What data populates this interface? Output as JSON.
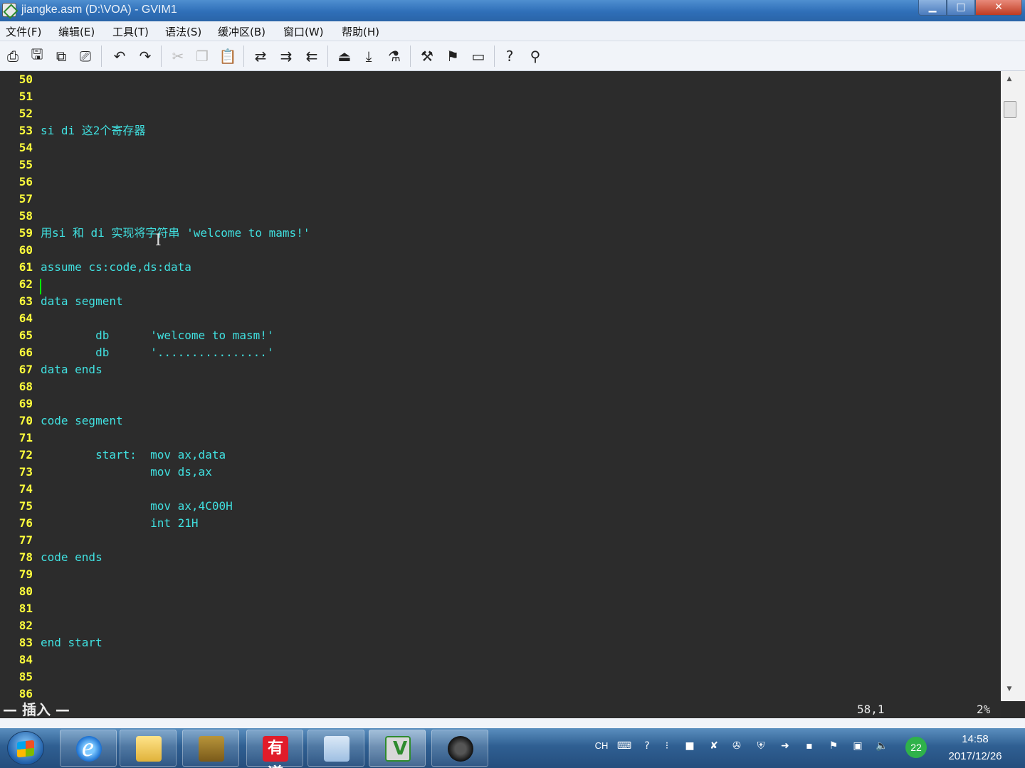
{
  "window": {
    "title": "jiangke.asm (D:\\VOA) - GVIM1",
    "minimize": "▁",
    "maximize": "□",
    "close": "✕"
  },
  "menu": [
    "文件(F)",
    "编辑(E)",
    "工具(T)",
    "语法(S)",
    "缓冲区(B)",
    "窗口(W)",
    "帮助(H)"
  ],
  "toolbar": {
    "icons": [
      "open-icon",
      "save-icon",
      "save-all-icon",
      "print-icon",
      "undo-icon",
      "redo-icon",
      "cut-icon",
      "copy-icon",
      "paste-icon",
      "find-replace-icon",
      "find-next-icon",
      "find-prev-icon",
      "load-session-icon",
      "save-session-icon",
      "run-script-icon",
      "make-icon",
      "shell-icon",
      "tag-jump-icon",
      "help-icon",
      "find-help-icon"
    ]
  },
  "editor": {
    "lines": [
      {
        "n": "50",
        "text": ""
      },
      {
        "n": "51",
        "text": ""
      },
      {
        "n": "52",
        "text": ""
      },
      {
        "n": "53",
        "text": "si di 这2个寄存器"
      },
      {
        "n": "54",
        "text": ""
      },
      {
        "n": "55",
        "text": ""
      },
      {
        "n": "56",
        "text": ""
      },
      {
        "n": "57",
        "text": ""
      },
      {
        "n": "58",
        "text": ""
      },
      {
        "n": "59",
        "text": "用si 和 di 实现将字符串 'welcome to mams!'"
      },
      {
        "n": "60",
        "text": ""
      },
      {
        "n": "61",
        "text": "assume cs:code,ds:data"
      },
      {
        "n": "62",
        "text": ""
      },
      {
        "n": "63",
        "text": "data segment"
      },
      {
        "n": "64",
        "text": ""
      },
      {
        "n": "65",
        "text": "        db      'welcome to masm!'"
      },
      {
        "n": "66",
        "text": "        db      '................'"
      },
      {
        "n": "67",
        "text": "data ends"
      },
      {
        "n": "68",
        "text": ""
      },
      {
        "n": "69",
        "text": ""
      },
      {
        "n": "70",
        "text": "code segment"
      },
      {
        "n": "71",
        "text": ""
      },
      {
        "n": "72",
        "text": "        start:  mov ax,data"
      },
      {
        "n": "73",
        "text": "                mov ds,ax"
      },
      {
        "n": "74",
        "text": ""
      },
      {
        "n": "75",
        "text": "                mov ax,4C00H"
      },
      {
        "n": "76",
        "text": "                int 21H"
      },
      {
        "n": "77",
        "text": ""
      },
      {
        "n": "78",
        "text": "code ends"
      },
      {
        "n": "79",
        "text": ""
      },
      {
        "n": "80",
        "text": ""
      },
      {
        "n": "81",
        "text": ""
      },
      {
        "n": "82",
        "text": ""
      },
      {
        "n": "83",
        "text": "end start"
      },
      {
        "n": "84",
        "text": ""
      },
      {
        "n": "85",
        "text": ""
      },
      {
        "n": "86",
        "text": ""
      }
    ]
  },
  "status": {
    "mode": "— 插入 —",
    "position": "58,1",
    "percent": "2%"
  },
  "taskbar": {
    "youdao_label": "有道",
    "tray_lang": "CH",
    "badge": "22",
    "time": "14:58",
    "date": "2017/12/26"
  },
  "colors": {
    "line_number": "#ffff3c",
    "code": "#40e0e0",
    "background": "#2c2c2c",
    "cursor": "#00ff00"
  }
}
